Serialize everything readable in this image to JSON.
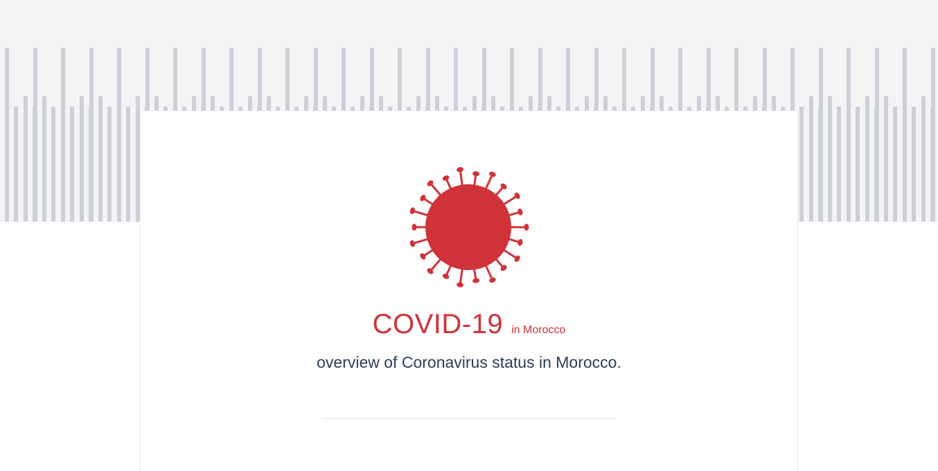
{
  "hero": {
    "title": "COVID-19",
    "location_tag": "in Morocco",
    "description": "overview of Coronavirus status in Morocco."
  },
  "colors": {
    "accent": "#d0323a",
    "text": "#2c3e57",
    "bars": "#cdd0d8",
    "band": "#f4f4f5"
  },
  "icons": {
    "virus": "coronavirus-icon"
  }
}
